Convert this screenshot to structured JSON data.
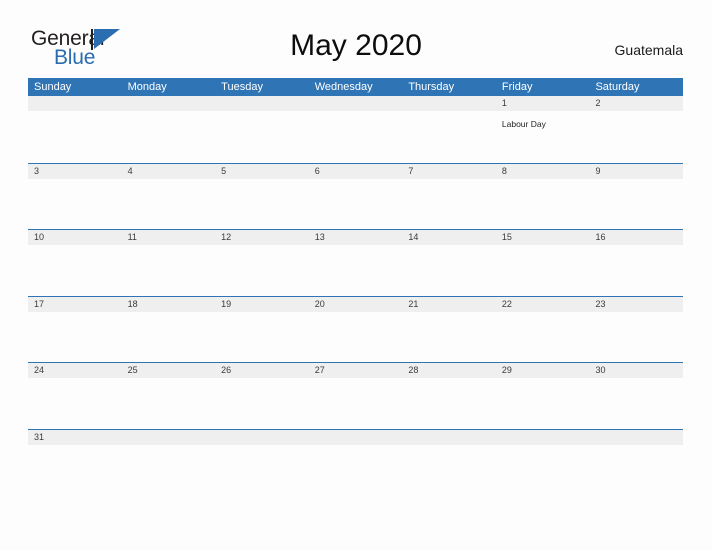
{
  "brand": {
    "name_part1": "General",
    "name_part2": "Blue",
    "flag_icon": "flag-triangle-icon",
    "accent_color": "#2a6db0"
  },
  "header": {
    "title": "May 2020",
    "location": "Guatemala"
  },
  "colors": {
    "header_band": "#2f74b5",
    "date_band": "#efefef",
    "row_rule": "#2f74b5",
    "page_background": "#fdfdfd",
    "title_text": "#0d0d0d",
    "date_text": "#3b3b3b"
  },
  "calendar": {
    "weekdays": [
      "Sunday",
      "Monday",
      "Tuesday",
      "Wednesday",
      "Thursday",
      "Friday",
      "Saturday"
    ],
    "weeks": [
      {
        "days": [
          {
            "date": "",
            "event": ""
          },
          {
            "date": "",
            "event": ""
          },
          {
            "date": "",
            "event": ""
          },
          {
            "date": "",
            "event": ""
          },
          {
            "date": "",
            "event": ""
          },
          {
            "date": "1",
            "event": "Labour Day"
          },
          {
            "date": "2",
            "event": ""
          }
        ]
      },
      {
        "days": [
          {
            "date": "3",
            "event": ""
          },
          {
            "date": "4",
            "event": ""
          },
          {
            "date": "5",
            "event": ""
          },
          {
            "date": "6",
            "event": ""
          },
          {
            "date": "7",
            "event": ""
          },
          {
            "date": "8",
            "event": ""
          },
          {
            "date": "9",
            "event": ""
          }
        ]
      },
      {
        "days": [
          {
            "date": "10",
            "event": ""
          },
          {
            "date": "11",
            "event": ""
          },
          {
            "date": "12",
            "event": ""
          },
          {
            "date": "13",
            "event": ""
          },
          {
            "date": "14",
            "event": ""
          },
          {
            "date": "15",
            "event": ""
          },
          {
            "date": "16",
            "event": ""
          }
        ]
      },
      {
        "days": [
          {
            "date": "17",
            "event": ""
          },
          {
            "date": "18",
            "event": ""
          },
          {
            "date": "19",
            "event": ""
          },
          {
            "date": "20",
            "event": ""
          },
          {
            "date": "21",
            "event": ""
          },
          {
            "date": "22",
            "event": ""
          },
          {
            "date": "23",
            "event": ""
          }
        ]
      },
      {
        "days": [
          {
            "date": "24",
            "event": ""
          },
          {
            "date": "25",
            "event": ""
          },
          {
            "date": "26",
            "event": ""
          },
          {
            "date": "27",
            "event": ""
          },
          {
            "date": "28",
            "event": ""
          },
          {
            "date": "29",
            "event": ""
          },
          {
            "date": "30",
            "event": ""
          }
        ]
      },
      {
        "days": [
          {
            "date": "31",
            "event": ""
          },
          {
            "date": "",
            "event": ""
          },
          {
            "date": "",
            "event": ""
          },
          {
            "date": "",
            "event": ""
          },
          {
            "date": "",
            "event": ""
          },
          {
            "date": "",
            "event": ""
          },
          {
            "date": "",
            "event": ""
          }
        ]
      }
    ]
  }
}
